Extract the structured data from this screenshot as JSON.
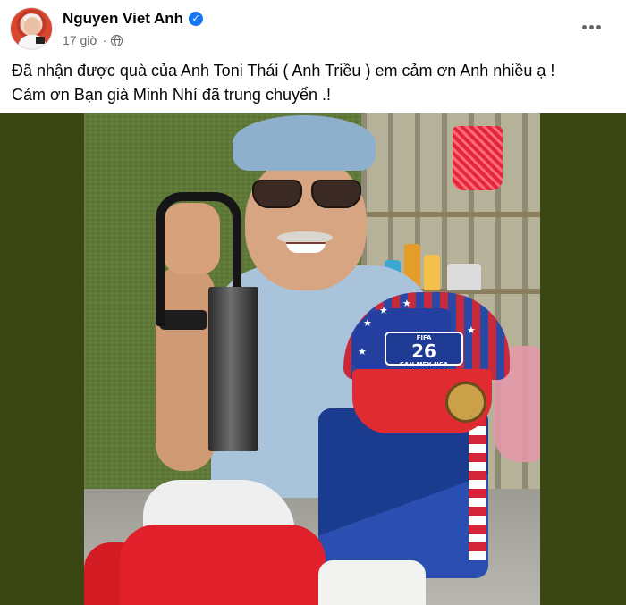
{
  "post": {
    "author": "Nguyen Viet Anh",
    "verified_icon": "verified-badge-icon",
    "time": "17 giờ",
    "separator": "·",
    "privacy_icon": "globe-icon",
    "caption_line1": "Đã nhận được quà của Anh Toni Thái ( Anh Triều ) em cảm ơn Anh nhiều ạ !",
    "caption_line2": "Cảm ơn Bạn già Minh Nhí đã trung chuyển .!",
    "more_icon": "more-options-icon"
  },
  "photo": {
    "cap_number": "26",
    "cap_fifa": "FIFA",
    "cap_text": "CAN MEX USA"
  },
  "colors": {
    "verified": "#1877f2",
    "meta_text": "#65676b",
    "side_background": "#3a4614"
  }
}
